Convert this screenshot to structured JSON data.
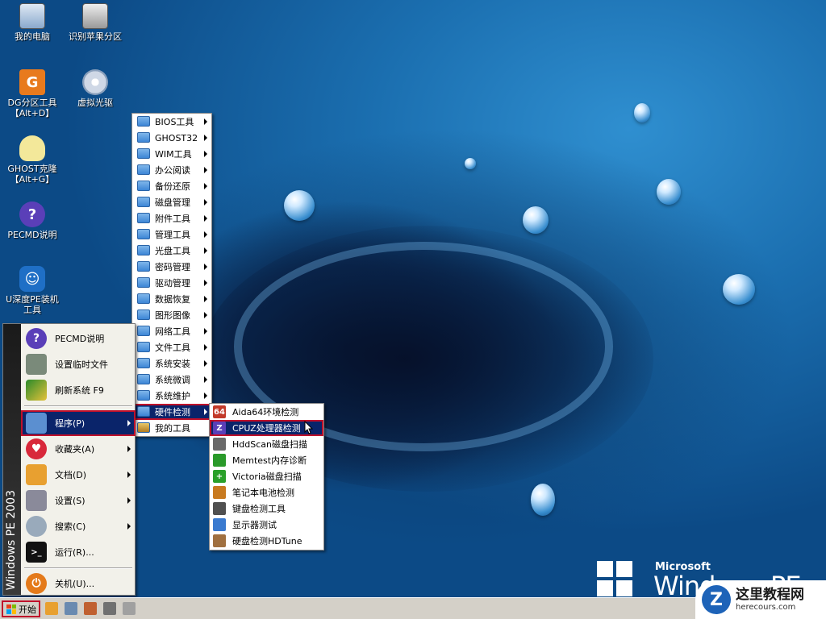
{
  "desktop": {
    "icons": [
      {
        "label": "我的电脑",
        "icon": "computer-icon"
      },
      {
        "label": "识别苹果分区",
        "icon": "disk-icon"
      },
      {
        "label": "DG分区工具\n【Alt+D】",
        "icon": "diskgenius-icon"
      },
      {
        "label": "虚拟光驱",
        "icon": "virtual-cdrom-icon"
      },
      {
        "label": "GHOST克隆\n【Alt+G】",
        "icon": "ghost-icon"
      },
      {
        "label": "PECMD说明",
        "icon": "help-icon"
      },
      {
        "label": "U深度PE装机\n工具",
        "icon": "installer-icon"
      }
    ],
    "logo": {
      "brand": "Microsoft",
      "product": "Windows PE"
    },
    "watermark": {
      "title": "这里教程网",
      "url": "herecours.com",
      "badge": "Z"
    }
  },
  "start_menu": {
    "band_text": "Windows PE 2003",
    "items": [
      {
        "label": "PECMD说明",
        "icon": "help-icon"
      },
      {
        "label": "设置临时文件",
        "icon": "chip-icon"
      },
      {
        "label": "刷新系统 F9",
        "icon": "refresh-icon"
      },
      {
        "label": "程序(P)",
        "icon": "programs-icon"
      },
      {
        "label": "收藏夹(A)",
        "icon": "heart-icon"
      },
      {
        "label": "文档(D)",
        "icon": "documents-icon"
      },
      {
        "label": "设置(S)",
        "icon": "settings-icon"
      },
      {
        "label": "搜索(C)",
        "icon": "search-icon"
      },
      {
        "label": "运行(R)...",
        "icon": "run-icon"
      },
      {
        "label": "关机(U)...",
        "icon": "shutdown-icon"
      }
    ]
  },
  "programs_menu": {
    "items": [
      "BIOS工具",
      "GHOST32",
      "WIM工具",
      "办公阅读",
      "备份还原",
      "磁盘管理",
      "附件工具",
      "管理工具",
      "光盘工具",
      "密码管理",
      "驱动管理",
      "数据恢复",
      "图形图像",
      "网络工具",
      "文件工具",
      "系统安装",
      "系统微调",
      "系统维护",
      "硬件检测",
      "我的工具"
    ]
  },
  "hardware_menu": {
    "items": [
      {
        "label": "Aida64环境检测",
        "icon": "aida64-icon",
        "glyph": "64"
      },
      {
        "label": "CPUZ处理器检测",
        "icon": "cpuz-icon",
        "glyph": "Z"
      },
      {
        "label": "HddScan磁盘扫描",
        "icon": "hddscan-icon",
        "glyph": ""
      },
      {
        "label": "Memtest内存诊断",
        "icon": "memtest-icon",
        "glyph": ""
      },
      {
        "label": "Victoria磁盘扫描",
        "icon": "victoria-icon",
        "glyph": "+"
      },
      {
        "label": "笔记本电池检测",
        "icon": "battery-icon",
        "glyph": ""
      },
      {
        "label": "键盘检测工具",
        "icon": "keyboard-icon",
        "glyph": ""
      },
      {
        "label": "显示器测试",
        "icon": "monitor-test-icon",
        "glyph": ""
      },
      {
        "label": "硬盘检测HDTune",
        "icon": "hdtune-icon",
        "glyph": ""
      }
    ]
  },
  "taskbar": {
    "start_label": "开始",
    "quick_launch": [
      "explorer-icon",
      "screenshot-icon",
      "tools-icon",
      "printer-icon",
      "eraser-icon"
    ]
  },
  "colors": {
    "menu_highlight": "#0a246a",
    "selection_outline": "#c0102a",
    "taskbar": "#d4d0c8"
  }
}
